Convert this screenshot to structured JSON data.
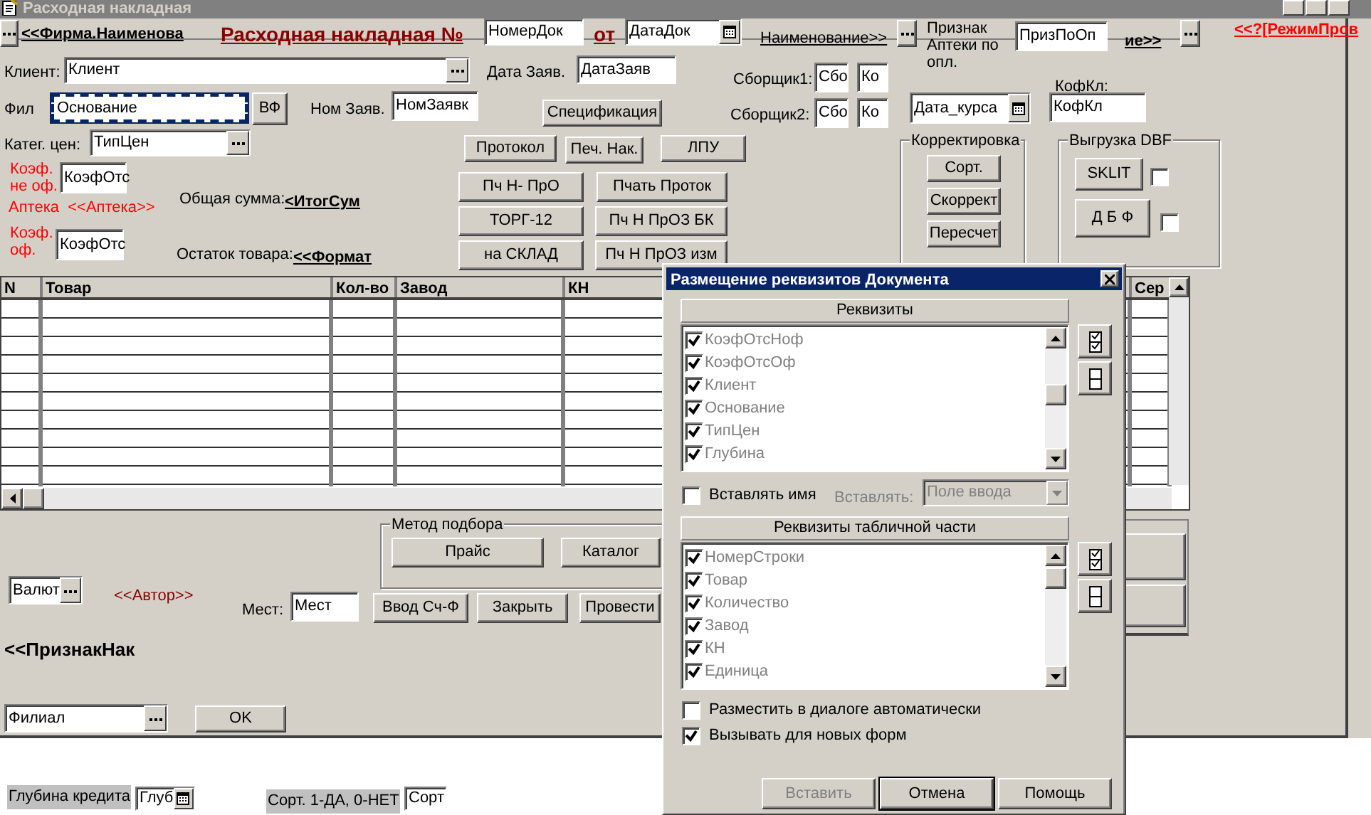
{
  "window": {
    "title": "Расходная накладная"
  },
  "form": {
    "controls": [
      {
        "kind": "browse",
        "selected": false
      },
      {
        "kind": "boldlink",
        "text": "<<Фирма.Наименова",
        "selected": false
      },
      {
        "kind": "heading",
        "text": "Расходная накладная №",
        "selected": false
      },
      {
        "kind": "field",
        "text": "НомерДок",
        "selected": false
      },
      {
        "kind": "heading",
        "text": "от",
        "selected": false
      },
      {
        "kind": "date",
        "text": "ДатаДок",
        "selected": false
      },
      {
        "kind": "link",
        "text": "Наименование>>",
        "selected": false
      },
      {
        "kind": "browse",
        "selected": false
      },
      {
        "kind": "label",
        "text": "Признак Аптеки по опл.",
        "selected": false
      },
      {
        "kind": "field",
        "text": "ПризПоОп",
        "selected": false
      },
      {
        "kind": "boldlink",
        "text": "ие>>",
        "selected": false
      },
      {
        "kind": "browse",
        "selected": false
      },
      {
        "kind": "alert",
        "text": "<<?[РежимПров",
        "selected": false
      },
      {
        "kind": "label",
        "text": "Клиент:",
        "selected": false
      },
      {
        "kind": "select",
        "text": "Клиент",
        "selected": false
      },
      {
        "kind": "label",
        "text": "Дата Заяв.",
        "selected": false
      },
      {
        "kind": "field",
        "text": "ДатаЗаяв",
        "selected": false
      },
      {
        "kind": "label",
        "text": "Сборщик1:",
        "selected": false
      },
      {
        "kind": "field",
        "text": "Сбо",
        "selected": false
      },
      {
        "kind": "field",
        "text": "Ко",
        "selected": false
      },
      {
        "kind": "label",
        "text": "Фил",
        "selected": false
      },
      {
        "kind": "field",
        "text": "Основание",
        "selected": true
      },
      {
        "kind": "button",
        "text": "ВФ",
        "selected": false
      },
      {
        "kind": "label",
        "text": "Ном Заяв.",
        "selected": false
      },
      {
        "kind": "field",
        "text": "НомЗаявк",
        "selected": false
      },
      {
        "kind": "button",
        "text": "Спецификация",
        "selected": false
      },
      {
        "kind": "label",
        "text": "Сборщик2:",
        "selected": false
      },
      {
        "kind": "field",
        "text": "Сбо",
        "selected": false
      },
      {
        "kind": "field",
        "text": "Ко",
        "selected": false
      },
      {
        "kind": "date",
        "text": "Дата_курса",
        "selected": false
      },
      {
        "kind": "label",
        "text": "КофКл:",
        "selected": false
      },
      {
        "kind": "field",
        "text": "КофКл",
        "selected": false
      },
      {
        "kind": "label",
        "text": "Катег. цен:",
        "selected": false
      },
      {
        "kind": "select",
        "text": "ТипЦен",
        "selected": false
      },
      {
        "kind": "button",
        "text": "Протокол",
        "selected": false
      },
      {
        "kind": "button",
        "text": "Печ. Нак.",
        "selected": false
      },
      {
        "kind": "button",
        "text": "ЛПУ",
        "selected": false
      },
      {
        "kind": "group",
        "text": "Корректировка",
        "selected": false
      },
      {
        "kind": "button",
        "text": "Сорт.",
        "selected": false
      },
      {
        "kind": "button",
        "text": "Скоррект",
        "selected": false
      },
      {
        "kind": "button",
        "text": "Пересчет",
        "selected": false
      },
      {
        "kind": "group",
        "text": "Выгрузка DBF",
        "selected": false
      },
      {
        "kind": "button",
        "text": "SKLIT",
        "selected": false
      },
      {
        "kind": "checkbox",
        "checked": false,
        "selected": false
      },
      {
        "kind": "button",
        "text": "Д Б Ф",
        "selected": false
      },
      {
        "kind": "checkbox",
        "checked": false,
        "selected": false
      },
      {
        "kind": "note",
        "text": "Коэф. не оф.",
        "selected": false
      },
      {
        "kind": "field",
        "text": "КоэфОтс",
        "selected": false
      },
      {
        "kind": "note",
        "text": "Аптека  <<Аптека>>",
        "selected": false
      },
      {
        "kind": "note",
        "text": "Коэф. оф.",
        "selected": false
      },
      {
        "kind": "field",
        "text": "КоэфОтс",
        "selected": false
      },
      {
        "kind": "label",
        "text": "Общая сумма:",
        "selected": false
      },
      {
        "kind": "boldlink",
        "text": "<ИтогСум",
        "selected": false
      },
      {
        "kind": "label",
        "text": "Остаток товара:",
        "selected": false
      },
      {
        "kind": "boldlink",
        "text": "<<Формат",
        "selected": false
      },
      {
        "kind": "button",
        "text": "Пч Н- ПрО",
        "selected": false
      },
      {
        "kind": "button",
        "text": "Пчать Проток",
        "selected": false
      },
      {
        "kind": "button",
        "text": "ТОРГ-12",
        "selected": false
      },
      {
        "kind": "button",
        "text": "Пч Н ПрОЗ БК",
        "selected": false
      },
      {
        "kind": "button",
        "text": "на СКЛАД",
        "selected": false
      },
      {
        "kind": "button",
        "text": "Пч Н ПрОЗ изм",
        "selected": false
      },
      {
        "kind": "group",
        "text": "Метод подбора",
        "selected": false
      },
      {
        "kind": "button",
        "text": "Прайс",
        "selected": false
      },
      {
        "kind": "button",
        "text": "Каталог",
        "selected": false
      },
      {
        "kind": "select",
        "text": "Валют",
        "selected": false
      },
      {
        "kind": "caption",
        "text": "<<Автор>>",
        "selected": false
      },
      {
        "kind": "label",
        "text": "Мест:",
        "selected": false
      },
      {
        "kind": "field",
        "text": "Мест",
        "selected": false
      },
      {
        "kind": "button",
        "text": "Ввод Сч-Ф",
        "selected": false
      },
      {
        "kind": "button",
        "text": "Закрыть",
        "selected": false
      },
      {
        "kind": "button",
        "text": "Провести",
        "selected": false
      },
      {
        "kind": "boldlabel",
        "text": "<<ПризнакНак",
        "selected": false
      },
      {
        "kind": "select",
        "text": "Филиал",
        "selected": false
      },
      {
        "kind": "button",
        "text": "OK",
        "selected": false
      },
      {
        "kind": "shaded",
        "text": "Глубина кредита",
        "selected": false
      },
      {
        "kind": "date",
        "text": "Глуб",
        "selected": false
      },
      {
        "kind": "shaded",
        "text": "Сорт. 1-ДА, 0-НЕТ",
        "selected": false
      },
      {
        "kind": "field",
        "text": "Сорт",
        "selected": false
      }
    ],
    "table": {
      "columns": [
        "N",
        "Товар",
        "Кол-во",
        "Завод",
        "КН",
        "Сер"
      ]
    }
  },
  "dialog": {
    "title": "Размещение реквизитов Документа",
    "lists": [
      {
        "header": "Реквизиты",
        "items": [
          {
            "text": "КоэфОтсНоф",
            "checked": true
          },
          {
            "text": "КоэфОтсОф",
            "checked": true
          },
          {
            "text": "Клиент",
            "checked": true
          },
          {
            "text": "Основание",
            "checked": true
          },
          {
            "text": "ТипЦен",
            "checked": true
          },
          {
            "text": "Глубина",
            "checked": true
          }
        ]
      },
      {
        "header": "Реквизиты табличной части",
        "items": [
          {
            "text": "НомерСтроки",
            "checked": true
          },
          {
            "text": "Товар",
            "checked": true
          },
          {
            "text": "Количество",
            "checked": true
          },
          {
            "text": "Завод",
            "checked": true
          },
          {
            "text": "КН",
            "checked": true
          },
          {
            "text": "Единица",
            "checked": true
          }
        ]
      }
    ],
    "insert_name": {
      "label": "Вставлять имя",
      "checked": false
    },
    "insert_as": {
      "label": "Вставлять:",
      "value": "Поле ввода",
      "disabled": true
    },
    "options": [
      {
        "label": "Разместить в диалоге автоматически",
        "checked": false
      },
      {
        "label": "Вызывать для новых форм",
        "checked": true
      }
    ],
    "buttons": [
      {
        "text": "Вставить",
        "disabled": true
      },
      {
        "text": "Отмена",
        "disabled": false
      },
      {
        "text": "Помощь",
        "disabled": false
      }
    ]
  }
}
